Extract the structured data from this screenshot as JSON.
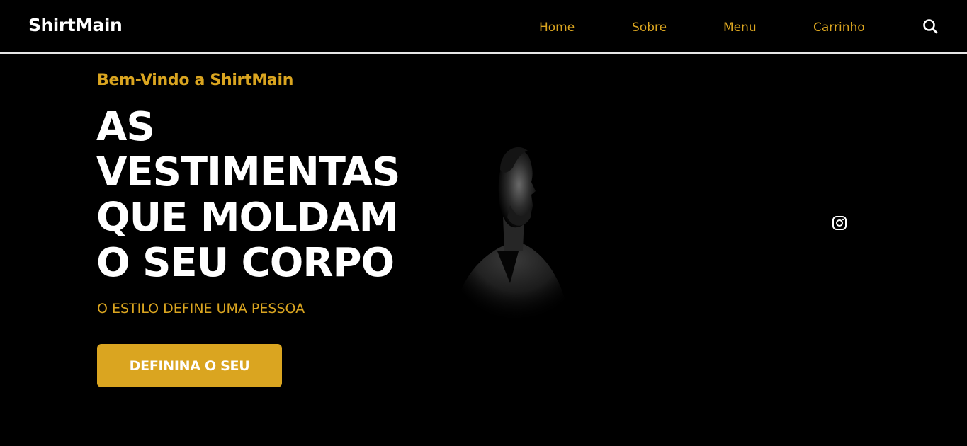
{
  "header": {
    "logo": "ShirtMain",
    "nav": [
      {
        "label": "Home"
      },
      {
        "label": "Sobre"
      },
      {
        "label": "Menu"
      },
      {
        "label": "Carrinho"
      }
    ],
    "search_icon": "search-icon"
  },
  "hero": {
    "welcome": "Bem-Vindo a ShirtMain",
    "headline_lines": [
      "AS",
      "VESTIMENTAS",
      "QUE MOLDAM",
      "O SEU CORPO"
    ],
    "subtitle": "O ESTILO DEFINE UMA PESSOA",
    "cta_label": "DEFININA O SEU",
    "image": "man-portrait-dark",
    "social_icon": "instagram-icon"
  },
  "colors": {
    "background": "#000000",
    "accent": "#daa520",
    "text": "#ffffff",
    "divider": "#e6e6e6"
  }
}
